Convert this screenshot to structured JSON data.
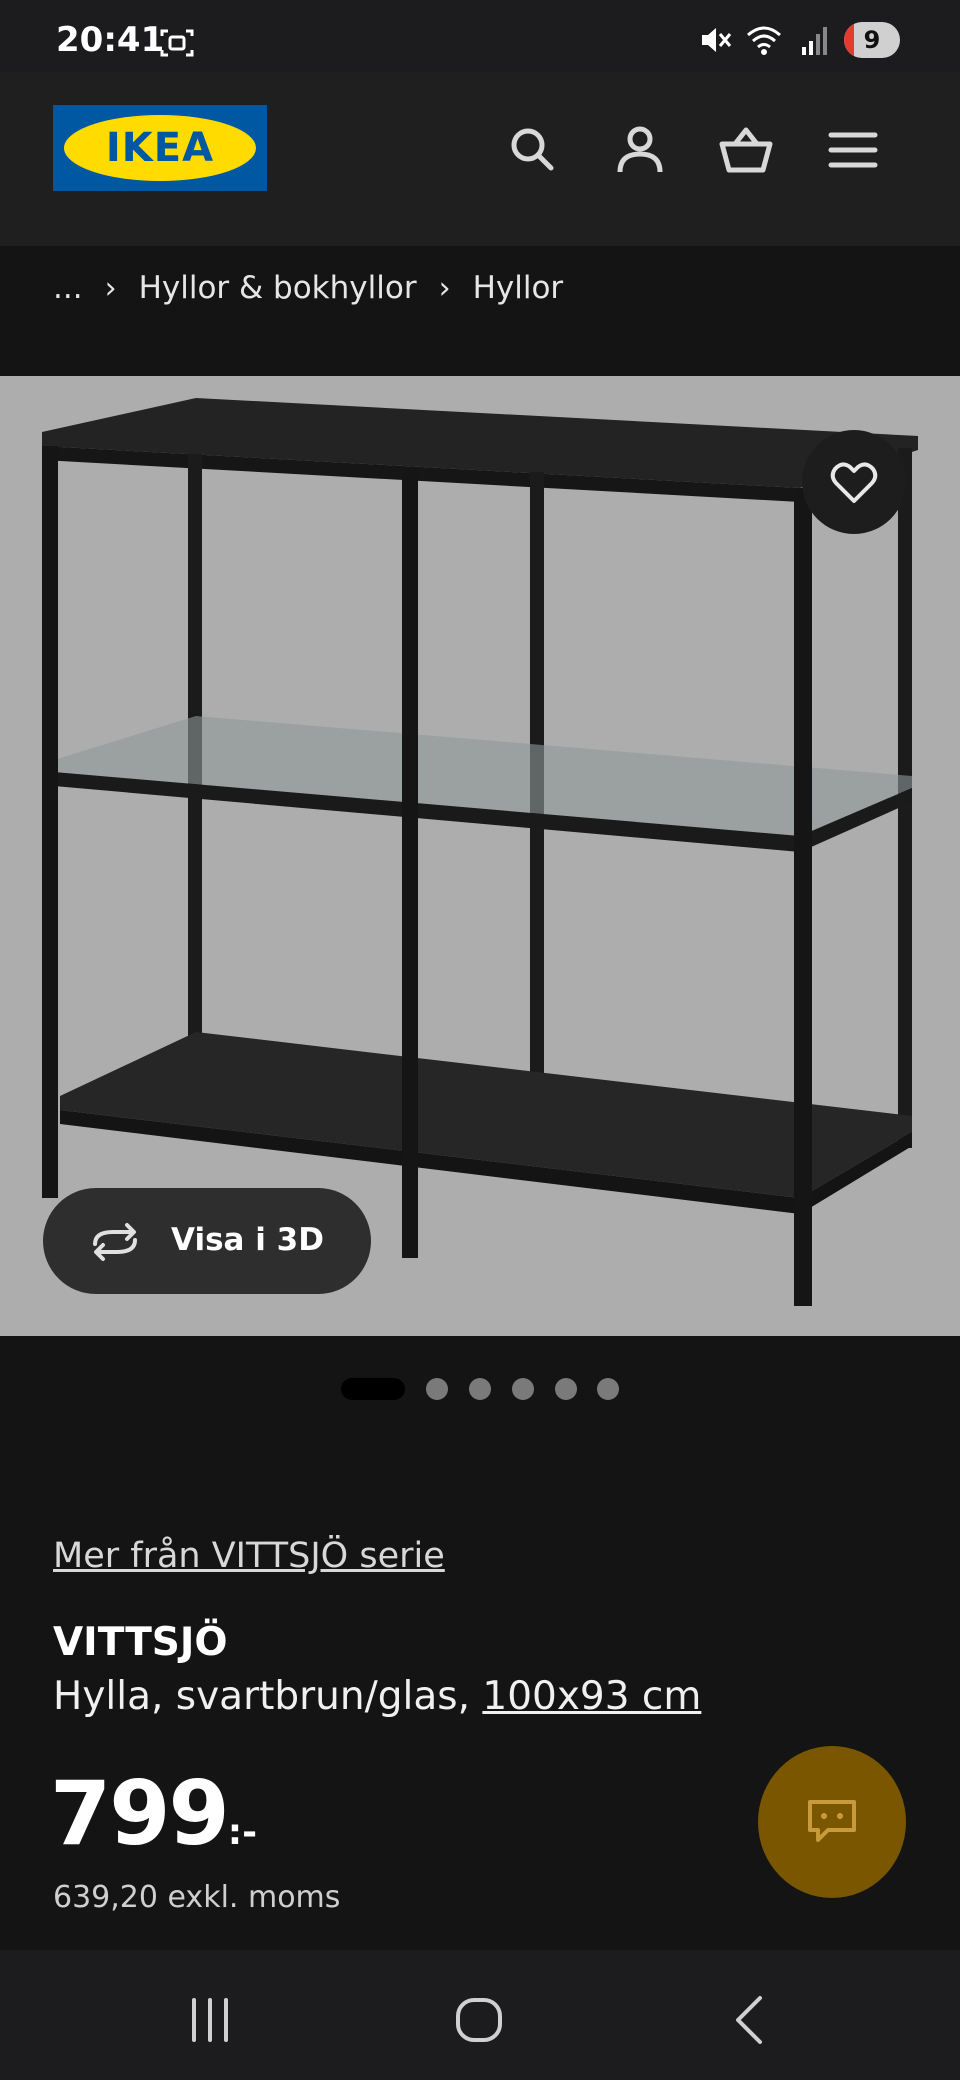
{
  "status": {
    "time": "20:41",
    "notification_count": "9"
  },
  "header": {
    "logo_text": "IKEA",
    "icons": [
      "search-icon",
      "user-icon",
      "basket-icon",
      "menu-icon"
    ]
  },
  "breadcrumb": {
    "items": [
      "...",
      "Hyllor & bokhyllor",
      "Hyllor"
    ]
  },
  "gallery": {
    "view_3d_label": "Visa i 3D",
    "image_count": 6,
    "active_index": 0
  },
  "product": {
    "series_link": "Mer från VITTSJÖ serie",
    "name": "VITTSJÖ",
    "description_prefix": "Hylla, svartbrun/glas, ",
    "size": "100x93 cm",
    "price": "799",
    "price_suffix": ":-",
    "price_excl_vat": "639,20 exkl. moms"
  },
  "colors": {
    "background": "#141414",
    "header": "#1f1f1f",
    "image_background": "#adadad",
    "chat_button": "#7a5600",
    "logo_blue": "#0058a3",
    "logo_yellow": "#ffdb00"
  }
}
